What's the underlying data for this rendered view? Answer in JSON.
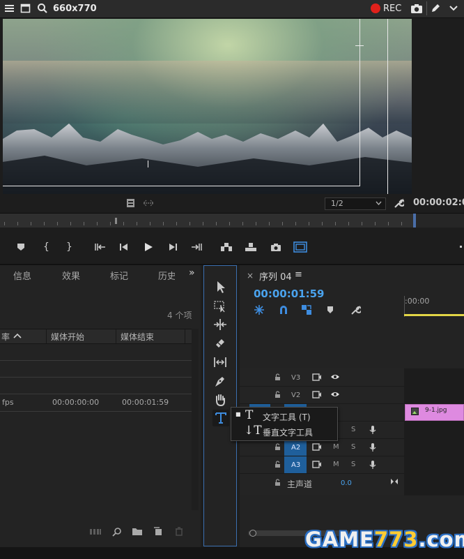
{
  "topbar": {
    "title": "660x770",
    "rec_label": "REC"
  },
  "monitor": {
    "zoom_value": "1/2",
    "timecode": "00:00:02:0"
  },
  "project_panel": {
    "tabs": [
      "信息",
      "效果",
      "标记",
      "历史"
    ],
    "overflow": "»",
    "item_count": "4 个项",
    "columns": [
      "率",
      "媒体开始",
      "媒体结束"
    ],
    "row": {
      "rate": "fps",
      "media_start": "00:00:00:00",
      "media_end": "00:00:01:59"
    }
  },
  "timeline": {
    "close": "×",
    "sequence": "序列 04",
    "menu": "≡",
    "timecode": "00:00:01:59",
    "ruler_time": ":00:00",
    "tracks": {
      "v3": "V3",
      "v2": "V2",
      "a2": "A2",
      "a3": "A3",
      "m": "M",
      "s": "S"
    },
    "clip_name": "9-1.jpg",
    "master_label": "主声道",
    "master_value": "0.0"
  },
  "context_menu": {
    "item1_label": "文字工具 (T)",
    "item1_glyph": "T",
    "item2_label": "垂直文字工具",
    "item2_glyph": "↓T",
    "bullet": "■"
  },
  "watermark": {
    "part1": "GAME",
    "part2": "773",
    "part3": ".com"
  },
  "colors": {
    "accent_blue": "#4aa3ee",
    "clip_pink": "#de8ae0",
    "rec_red": "#e0211b",
    "track_blue": "#1f5f9b",
    "work_yellow": "#e2d646"
  }
}
